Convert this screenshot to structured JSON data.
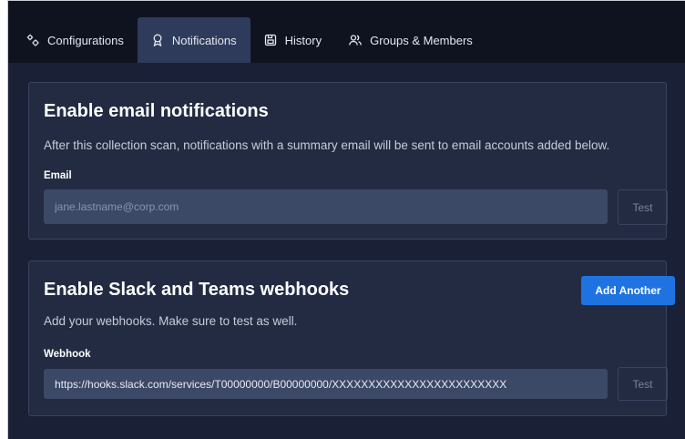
{
  "tabs": [
    {
      "label": "Configurations",
      "icon": "gears-icon",
      "active": false
    },
    {
      "label": "Notifications",
      "icon": "award-icon",
      "active": true
    },
    {
      "label": "History",
      "icon": "save-icon",
      "active": false
    },
    {
      "label": "Groups & Members",
      "icon": "users-icon",
      "active": false
    }
  ],
  "email_section": {
    "title": "Enable email notifications",
    "description": "After this collection scan, notifications with a summary email will be sent to email accounts added below.",
    "field_label": "Email",
    "placeholder": "jane.lastname@corp.com",
    "value": "",
    "test_label": "Test"
  },
  "webhook_section": {
    "title": "Enable Slack and Teams webhooks",
    "add_label": "Add Another",
    "description": "Add your webhooks. Make sure to test as well.",
    "field_label": "Webhook",
    "value": "https://hooks.slack.com/services/T00000000/B00000000/XXXXXXXXXXXXXXXXXXXXXXXX",
    "test_label": "Test"
  },
  "colors": {
    "background": "#1a2035",
    "tabbar": "#0f1320",
    "active_tab": "#2e3b5a",
    "card": "#232b42",
    "input": "#3b4866",
    "primary": "#1f73e0"
  }
}
